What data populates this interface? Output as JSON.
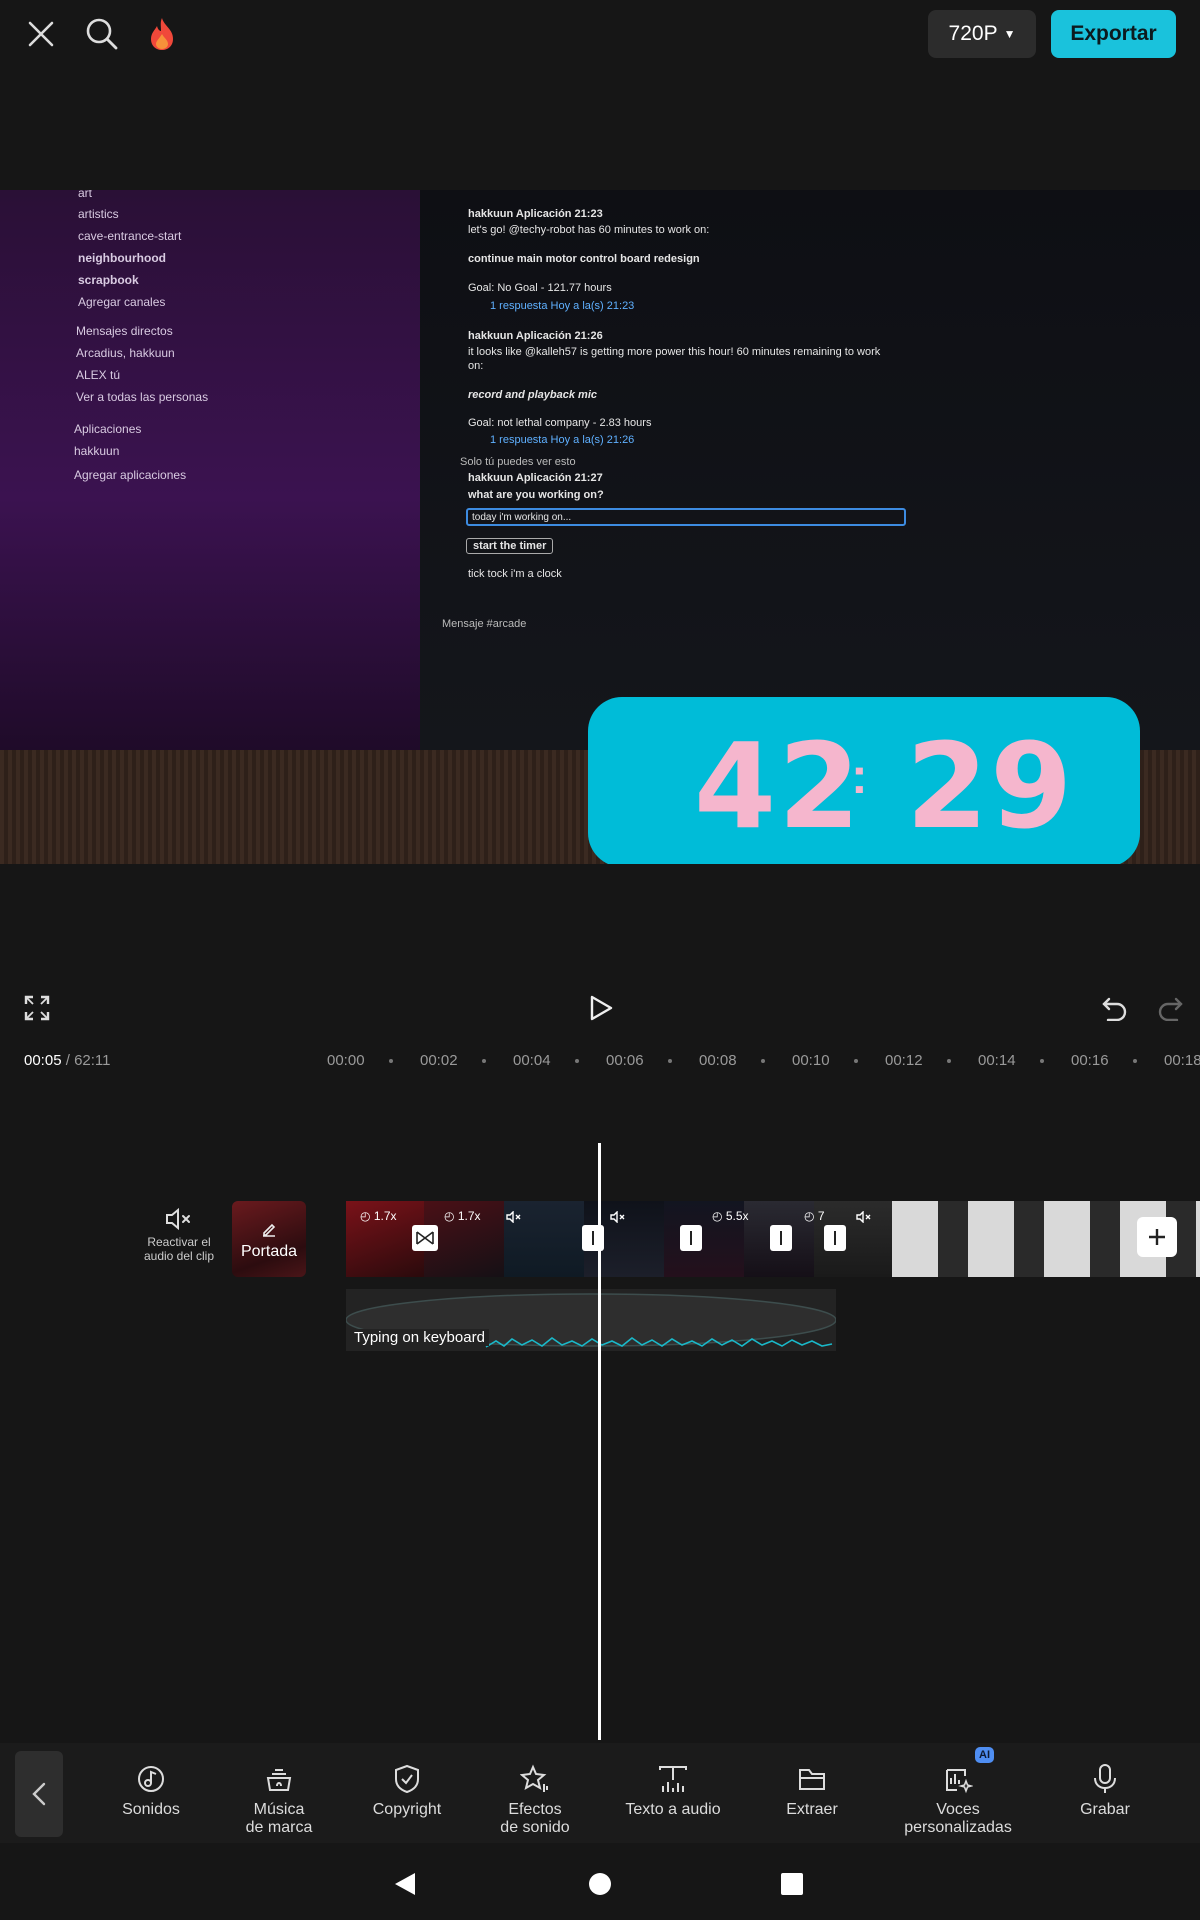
{
  "topbar": {
    "resolution_label": "720P",
    "export_label": "Exportar"
  },
  "preview": {
    "sidebar_lines": [
      "art",
      "artistics",
      "cave-entrance-start",
      "neighbourhood",
      "scrapbook",
      "Agregar canales",
      "Mensajes directos",
      "Arcadius, hakkuun",
      "ALEX tú",
      "Ver a todas las personas",
      "Aplicaciones",
      "hakkuun",
      "Agregar aplicaciones"
    ],
    "chat_lines": [
      "hakkuun  Aplicación  21:23",
      "let's go! @techy-robot has 60 minutes to work on:",
      "continue main motor control board redesign",
      "Goal: No Goal - 121.77 hours",
      "1 respuesta  Hoy a la(s) 21:23",
      "hakkuun  Aplicación  21:26",
      "it looks like @kalleh57 is getting more power this hour! 60 minutes remaining to work",
      "on:",
      "record and playback mic",
      "Goal: not lethal company - 2.83 hours",
      "1 respuesta  Hoy a la(s) 21:26",
      "Solo tú puedes ver esto",
      "hakkuun  Aplicación  21:27",
      "what are you working on?",
      "today i'm working on...",
      "start the timer",
      "tick tock i'm a clock",
      "Mensaje #arcade"
    ],
    "timer_minutes": "42",
    "timer_seconds": "29"
  },
  "ruler": {
    "current": "00:05",
    "separator": "/",
    "total": "62:11",
    "ticks": [
      "00:00",
      "00:02",
      "00:04",
      "00:06",
      "00:08",
      "00:10",
      "00:12",
      "00:14",
      "00:16",
      "00:18"
    ]
  },
  "timeline": {
    "mute_label_line1": "Reactivar el",
    "mute_label_line2": "audio del clip",
    "cover_label": "Portada",
    "speeds": [
      "1.7x",
      "1.7x",
      "5.5x",
      "7"
    ],
    "audio_label": "Typing on keyboard"
  },
  "toolbar": {
    "items": [
      {
        "l1": "Sonidos",
        "l2": "",
        "icon": "music-note-icon"
      },
      {
        "l1": "Música",
        "l2": "de marca",
        "icon": "brand-music-icon"
      },
      {
        "l1": "Copyright",
        "l2": "",
        "icon": "shield-check-icon"
      },
      {
        "l1": "Efectos",
        "l2": "de sonido",
        "icon": "sound-effects-icon"
      },
      {
        "l1": "Texto a audio",
        "l2": "",
        "icon": "text-to-audio-icon"
      },
      {
        "l1": "Extraer",
        "l2": "",
        "icon": "folder-icon"
      },
      {
        "l1": "Voces",
        "l2": "personalizadas",
        "icon": "custom-voice-icon"
      },
      {
        "l1": "Grabar",
        "l2": "",
        "icon": "microphone-icon"
      }
    ],
    "ai_badge": "AI"
  },
  "colors": {
    "accent": "#1ac2dc",
    "timer_bg": "#00bcd8",
    "timer_digits": "#f5b6cd",
    "background": "#161616"
  }
}
